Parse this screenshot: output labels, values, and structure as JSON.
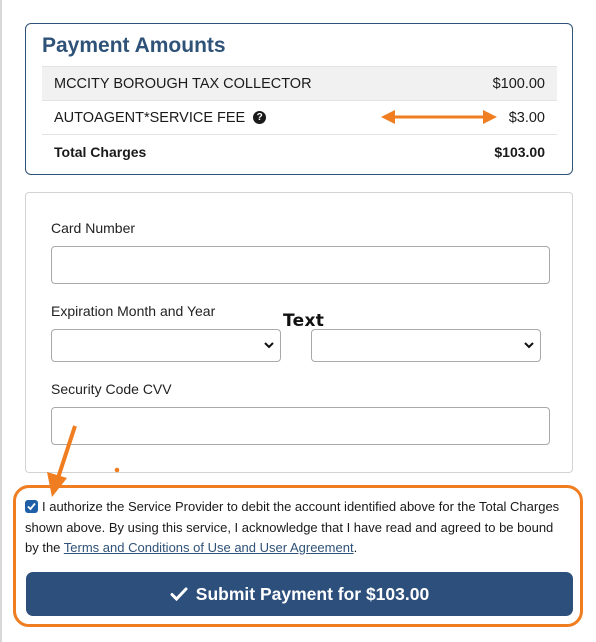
{
  "payment_amounts": {
    "title": "Payment Amounts",
    "rows": [
      {
        "label": "MCCITY BOROUGH TAX COLLECTOR",
        "amount": "$100.00"
      },
      {
        "label": "AUTOAGENT*SERVICE FEE",
        "amount": "$3.00",
        "icon": "help-icon"
      }
    ],
    "total": {
      "label": "Total Charges",
      "amount": "$103.00"
    }
  },
  "card_form": {
    "card_number_label": "Card Number",
    "card_number_value": "",
    "expiration_label": "Expiration Month and Year",
    "expiration_month_value": "",
    "expiration_year_value": "",
    "cvv_label": "Security Code CVV",
    "cvv_value": ""
  },
  "overlay_annotation_text": "Text",
  "authorization": {
    "checked": true,
    "text": "I authorize the Service Provider to debit the account identified above for the Total Charges shown above. By using this service, I acknowledge that I have read and agreed to be bound by the ",
    "link_text": "Terms and Conditions of Use and User Agreement",
    "trailing": "."
  },
  "submit_button": {
    "label": "Submit Payment for $103.00",
    "icon": "checkmark-icon"
  },
  "colors": {
    "primary": "#2d4f7c",
    "annotation_orange": "#f07d20",
    "checkbox_blue": "#1f5fa8"
  }
}
